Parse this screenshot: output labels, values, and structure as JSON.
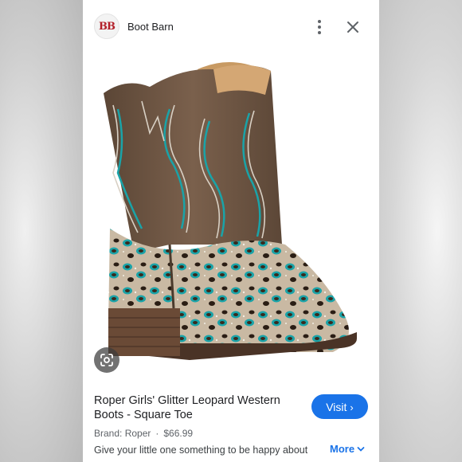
{
  "header": {
    "logo_text": "BB",
    "site_name": "Boot Barn",
    "more_icon": "more-vertical-icon",
    "close_icon": "close-icon"
  },
  "image": {
    "subject": "Brown cowboy boot with turquoise stitching and glitter leopard print vamp"
  },
  "lens_icon": "google-lens-icon",
  "product": {
    "title": "Roper Girls' Glitter Leopard Western Boots - Square Toe",
    "brand": "Brand: Roper",
    "separator": "·",
    "price": "$66.99",
    "description": "Give your little one something to be happy about",
    "visit_label": "Visit",
    "visit_chevron": "›",
    "more_label": "More"
  },
  "colors": {
    "accent": "#1a73e8",
    "logo_red": "#b3202a",
    "boot_brown": "#6b5544",
    "turquoise": "#1aa3a8"
  }
}
